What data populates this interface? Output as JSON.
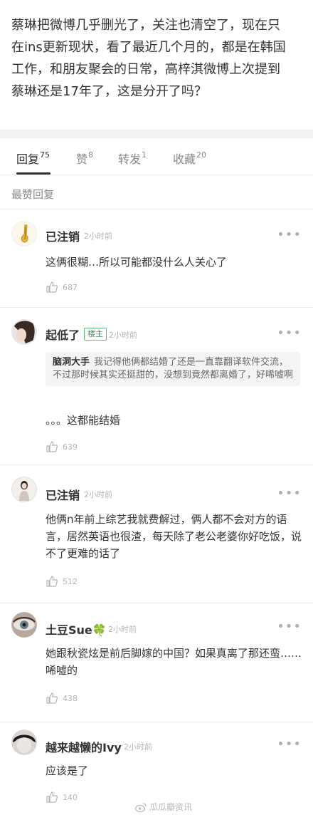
{
  "post": {
    "lines": [
      "蔡琳把微博几乎删光了，关注也清空了，现在只",
      "在ins更新现状，看了最近几个月的，都是在韩国",
      "工作，和朋友聚会的日常，高梓淇微博上次提到",
      "蔡琳还是17年了，这是分开了吗？"
    ]
  },
  "tabs": [
    {
      "label": "回复",
      "count": "75"
    },
    {
      "label": "赞",
      "count": "8"
    },
    {
      "label": "转发",
      "count": "1"
    },
    {
      "label": "收藏",
      "count": "20"
    }
  ],
  "section_title": "最赞回复",
  "comments": [
    {
      "name": "已注销",
      "time": "2小时前",
      "body": "这俩很糊…所以可能都没什么人关心了",
      "likes": "687"
    },
    {
      "name": "起低了",
      "badge": "楼主",
      "time": "2小时前",
      "quote_name": "脑洞大手",
      "quote_text": "我记得他俩都结婚了还是一直靠翻译软件交流，不过那时候其实还挺甜的，没想到竟然都离婚了，好唏嘘啊",
      "body": "。。。这都能结婚",
      "likes": "639"
    },
    {
      "name": "已注销",
      "time": "2小时前",
      "body": "他俩n年前上综艺我就费解过，俩人都不会对方的语言，居然英语也很渣，每天除了老公老婆你好吃饭，说不了更难的话了",
      "likes": "512"
    },
    {
      "name": "土豆Sue🍀",
      "time": "2小时前",
      "body": "她跟秋瓷炫是前后脚嫁的中国？如果真离了那还蛮……唏嘘的",
      "likes": "438"
    },
    {
      "name": "越来越懒的Ivy",
      "time": "2小时前",
      "body": "应该是了",
      "likes": "140"
    }
  ],
  "more_label": "•••",
  "watermark": "瓜瓜瓣资讯"
}
